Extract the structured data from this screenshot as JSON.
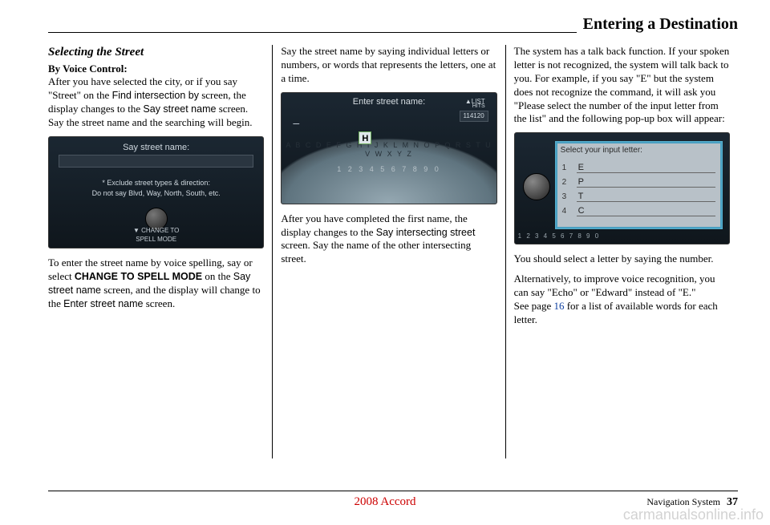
{
  "header": {
    "title": "Entering a Destination"
  },
  "col1": {
    "section_title": "Selecting the Street",
    "subhead": "By Voice Control:",
    "p1a": "After you have selected the city, or if you say \"Street\" on the ",
    "p1b": "Find intersection by",
    "p1c": " screen, the display changes to the ",
    "p1d": "Say street name",
    "p1e": " screen. Say the street name and the searching will begin.",
    "shot1": {
      "title": "Say street name:",
      "msg1": "* Exclude street types & direction:",
      "msg2": "Do not say Blvd, Way, North, South, etc.",
      "bottom": "▼ CHANGE TO\nSPELL MODE"
    },
    "p2a": "To enter the street name by voice spelling, say or select ",
    "p2b": "CHANGE TO SPELL MODE",
    "p2c": " on the ",
    "p2d": "Say street name",
    "p2e": " screen, and the display will change to the ",
    "p2f": "Enter street name",
    "p2g": " screen."
  },
  "col2": {
    "p1": "Say the street name by saying individual letters or numbers, or words that represents the letters, one at a time.",
    "shot2": {
      "header": "Enter street name:",
      "list": "▲LIST",
      "hits_label": "HITS",
      "hits": "114120",
      "selected": "H",
      "letters": "A B C D E F G H I J K L M N O P Q R S T U V W X Y Z",
      "numbers": "1 2 3 4 5 6 7 8 9 0",
      "dash": "–"
    },
    "p2a": "After you have completed the first name, the display changes to the ",
    "p2b": "Say intersecting street",
    "p2c": " screen. Say the name of the other intersecting street."
  },
  "col3": {
    "p1": "The system has a talk back function. If your spoken letter is not recognized, the system will talk back to you. For example, if you say \"E\" but the system does not recognize the command, it will ask you \"Please select the number of the input letter from the list\" and the following pop-up box will appear:",
    "shot3": {
      "title": "Select your input letter:",
      "rows": [
        {
          "n": "1",
          "v": "E"
        },
        {
          "n": "2",
          "v": "P"
        },
        {
          "n": "3",
          "v": "T"
        },
        {
          "n": "4",
          "v": "C"
        }
      ],
      "bg": "1 2 3 4 5 6 7 8 9 0"
    },
    "p2": "You should select a letter by saying the number.",
    "p3a": "Alternatively, to improve voice recognition, you can say \"Echo\" or \"Edward\" instead of \"E.\"",
    "p3b": "See page ",
    "p3c": "16",
    "p3d": " for a list of available words for each letter."
  },
  "footer": {
    "year_model": "2008  Accord",
    "section": "Navigation System",
    "page": "37"
  },
  "watermark": "carmanualsonline.info"
}
